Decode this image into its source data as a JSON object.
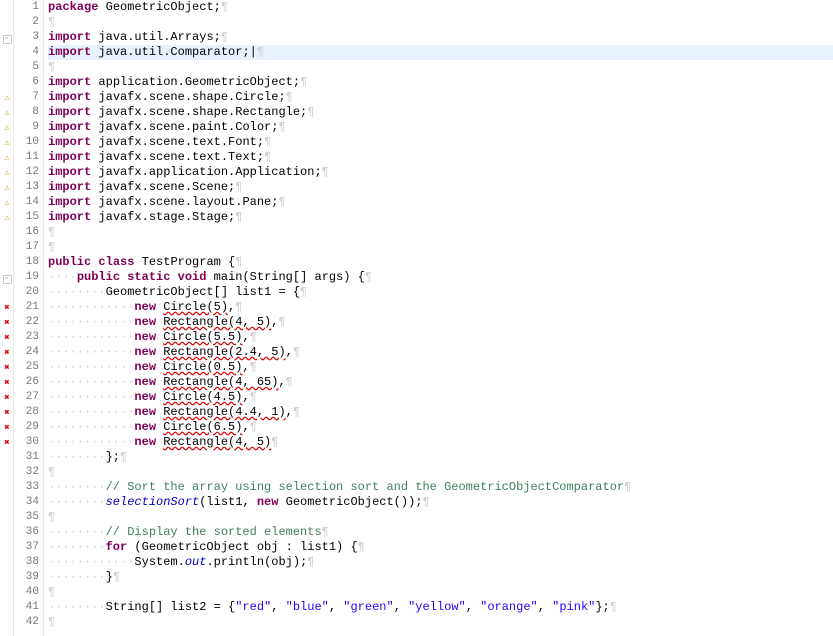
{
  "lines": [
    {
      "num": "1",
      "marker": "",
      "code": [
        {
          "t": "kw",
          "v": "package"
        },
        {
          "t": "ws",
          "v": " "
        },
        {
          "t": "d",
          "v": "GeometricObject;"
        },
        {
          "t": "ws",
          "v": "¶"
        }
      ]
    },
    {
      "num": "2",
      "marker": "",
      "code": [
        {
          "t": "ws",
          "v": "¶"
        }
      ]
    },
    {
      "num": "3",
      "marker": "fold",
      "code": [
        {
          "t": "kw",
          "v": "import"
        },
        {
          "t": "ws",
          "v": " "
        },
        {
          "t": "d",
          "v": "java.util.Arrays;"
        },
        {
          "t": "ws",
          "v": "¶"
        }
      ]
    },
    {
      "num": "4",
      "marker": "",
      "highlight": true,
      "code": [
        {
          "t": "kw",
          "v": "import"
        },
        {
          "t": "ws",
          "v": " "
        },
        {
          "t": "d",
          "v": "java.util.Comparator;"
        },
        {
          "t": "d",
          "v": "|"
        },
        {
          "t": "ws",
          "v": "¶"
        }
      ]
    },
    {
      "num": "5",
      "marker": "",
      "code": [
        {
          "t": "ws",
          "v": "¶"
        }
      ]
    },
    {
      "num": "6",
      "marker": "",
      "code": [
        {
          "t": "kw",
          "v": "import"
        },
        {
          "t": "ws",
          "v": " "
        },
        {
          "t": "d",
          "v": "application.GeometricObject;"
        },
        {
          "t": "ws",
          "v": "¶"
        }
      ]
    },
    {
      "num": "7",
      "marker": "warn",
      "code": [
        {
          "t": "kw",
          "v": "import"
        },
        {
          "t": "ws",
          "v": " "
        },
        {
          "t": "d",
          "v": "javafx.scene.shape.Circle;"
        },
        {
          "t": "ws",
          "v": "¶"
        }
      ]
    },
    {
      "num": "8",
      "marker": "warn",
      "code": [
        {
          "t": "kw",
          "v": "import"
        },
        {
          "t": "ws",
          "v": " "
        },
        {
          "t": "d",
          "v": "javafx.scene.shape.Rectangle;"
        },
        {
          "t": "ws",
          "v": "¶"
        }
      ]
    },
    {
      "num": "9",
      "marker": "warn",
      "code": [
        {
          "t": "kw",
          "v": "import"
        },
        {
          "t": "ws",
          "v": " "
        },
        {
          "t": "d",
          "v": "javafx.scene.paint.Color;"
        },
        {
          "t": "ws",
          "v": "¶"
        }
      ]
    },
    {
      "num": "10",
      "marker": "warn",
      "code": [
        {
          "t": "kw",
          "v": "import"
        },
        {
          "t": "ws",
          "v": " "
        },
        {
          "t": "d",
          "v": "javafx.scene.text.Font;"
        },
        {
          "t": "ws",
          "v": "¶"
        }
      ]
    },
    {
      "num": "11",
      "marker": "warn",
      "code": [
        {
          "t": "kw",
          "v": "import"
        },
        {
          "t": "ws",
          "v": " "
        },
        {
          "t": "d",
          "v": "javafx.scene.text.Text;"
        },
        {
          "t": "ws",
          "v": "¶"
        }
      ]
    },
    {
      "num": "12",
      "marker": "warn",
      "code": [
        {
          "t": "kw",
          "v": "import"
        },
        {
          "t": "ws",
          "v": " "
        },
        {
          "t": "d",
          "v": "javafx.application.Application;"
        },
        {
          "t": "ws",
          "v": "¶"
        }
      ]
    },
    {
      "num": "13",
      "marker": "warn",
      "code": [
        {
          "t": "kw",
          "v": "import"
        },
        {
          "t": "ws",
          "v": " "
        },
        {
          "t": "d",
          "v": "javafx.scene.Scene;"
        },
        {
          "t": "ws",
          "v": "¶"
        }
      ]
    },
    {
      "num": "14",
      "marker": "warn",
      "code": [
        {
          "t": "kw",
          "v": "import"
        },
        {
          "t": "ws",
          "v": " "
        },
        {
          "t": "d",
          "v": "javafx.scene.layout.Pane;"
        },
        {
          "t": "ws",
          "v": "¶"
        }
      ]
    },
    {
      "num": "15",
      "marker": "warn",
      "code": [
        {
          "t": "kw",
          "v": "import"
        },
        {
          "t": "ws",
          "v": " "
        },
        {
          "t": "d",
          "v": "javafx.stage.Stage;"
        },
        {
          "t": "ws",
          "v": "¶"
        }
      ]
    },
    {
      "num": "16",
      "marker": "",
      "code": [
        {
          "t": "ws",
          "v": "¶"
        }
      ]
    },
    {
      "num": "17",
      "marker": "",
      "code": [
        {
          "t": "ws",
          "v": "¶"
        }
      ]
    },
    {
      "num": "18",
      "marker": "",
      "code": [
        {
          "t": "kw",
          "v": "public"
        },
        {
          "t": "ws",
          "v": " "
        },
        {
          "t": "kw",
          "v": "class"
        },
        {
          "t": "ws",
          "v": " "
        },
        {
          "t": "d",
          "v": "TestProgram {"
        },
        {
          "t": "ws",
          "v": "¶"
        }
      ]
    },
    {
      "num": "19",
      "marker": "fold",
      "code": [
        {
          "t": "ws",
          "v": "····"
        },
        {
          "t": "kw",
          "v": "public"
        },
        {
          "t": "ws",
          "v": " "
        },
        {
          "t": "kw",
          "v": "static"
        },
        {
          "t": "ws",
          "v": " "
        },
        {
          "t": "kw",
          "v": "void"
        },
        {
          "t": "ws",
          "v": " "
        },
        {
          "t": "d",
          "v": "main(String[] args) {"
        },
        {
          "t": "ws",
          "v": "¶"
        }
      ]
    },
    {
      "num": "20",
      "marker": "",
      "code": [
        {
          "t": "ws",
          "v": "········"
        },
        {
          "t": "d",
          "v": "GeometricObject[] list1 = {"
        },
        {
          "t": "ws",
          "v": "¶"
        }
      ]
    },
    {
      "num": "21",
      "marker": "err",
      "code": [
        {
          "t": "ws",
          "v": "············"
        },
        {
          "t": "kw",
          "v": "new"
        },
        {
          "t": "ws",
          "v": " "
        },
        {
          "t": "err-u",
          "v": "Circle(5)"
        },
        {
          "t": "d",
          "v": ","
        },
        {
          "t": "ws",
          "v": "¶"
        }
      ]
    },
    {
      "num": "22",
      "marker": "err",
      "code": [
        {
          "t": "ws",
          "v": "············"
        },
        {
          "t": "kw",
          "v": "new"
        },
        {
          "t": "ws",
          "v": " "
        },
        {
          "t": "err-u",
          "v": "Rectangle(4, 5)"
        },
        {
          "t": "d",
          "v": ","
        },
        {
          "t": "ws",
          "v": "¶"
        }
      ]
    },
    {
      "num": "23",
      "marker": "err",
      "code": [
        {
          "t": "ws",
          "v": "············"
        },
        {
          "t": "kw",
          "v": "new"
        },
        {
          "t": "ws",
          "v": " "
        },
        {
          "t": "err-u",
          "v": "Circle(5.5)"
        },
        {
          "t": "d",
          "v": ","
        },
        {
          "t": "ws",
          "v": "¶"
        }
      ]
    },
    {
      "num": "24",
      "marker": "err",
      "code": [
        {
          "t": "ws",
          "v": "············"
        },
        {
          "t": "kw",
          "v": "new"
        },
        {
          "t": "ws",
          "v": " "
        },
        {
          "t": "err-u",
          "v": "Rectangle(2.4, 5)"
        },
        {
          "t": "d",
          "v": ","
        },
        {
          "t": "ws",
          "v": "¶"
        }
      ]
    },
    {
      "num": "25",
      "marker": "err",
      "code": [
        {
          "t": "ws",
          "v": "············"
        },
        {
          "t": "kw",
          "v": "new"
        },
        {
          "t": "ws",
          "v": " "
        },
        {
          "t": "err-u",
          "v": "Circle(0.5)"
        },
        {
          "t": "d",
          "v": ","
        },
        {
          "t": "ws",
          "v": "¶"
        }
      ]
    },
    {
      "num": "26",
      "marker": "err",
      "code": [
        {
          "t": "ws",
          "v": "············"
        },
        {
          "t": "kw",
          "v": "new"
        },
        {
          "t": "ws",
          "v": " "
        },
        {
          "t": "err-u",
          "v": "Rectangle(4, 65)"
        },
        {
          "t": "d",
          "v": ","
        },
        {
          "t": "ws",
          "v": "¶"
        }
      ]
    },
    {
      "num": "27",
      "marker": "err",
      "code": [
        {
          "t": "ws",
          "v": "············"
        },
        {
          "t": "kw",
          "v": "new"
        },
        {
          "t": "ws",
          "v": " "
        },
        {
          "t": "err-u",
          "v": "Circle(4.5)"
        },
        {
          "t": "d",
          "v": ","
        },
        {
          "t": "ws",
          "v": "¶"
        }
      ]
    },
    {
      "num": "28",
      "marker": "err",
      "code": [
        {
          "t": "ws",
          "v": "············"
        },
        {
          "t": "kw",
          "v": "new"
        },
        {
          "t": "ws",
          "v": " "
        },
        {
          "t": "err-u",
          "v": "Rectangle(4.4, 1)"
        },
        {
          "t": "d",
          "v": ","
        },
        {
          "t": "ws",
          "v": "¶"
        }
      ]
    },
    {
      "num": "29",
      "marker": "err",
      "code": [
        {
          "t": "ws",
          "v": "············"
        },
        {
          "t": "kw",
          "v": "new"
        },
        {
          "t": "ws",
          "v": " "
        },
        {
          "t": "err-u",
          "v": "Circle(6.5)"
        },
        {
          "t": "d",
          "v": ","
        },
        {
          "t": "ws",
          "v": "¶"
        }
      ]
    },
    {
      "num": "30",
      "marker": "err",
      "code": [
        {
          "t": "ws",
          "v": "············"
        },
        {
          "t": "kw",
          "v": "new"
        },
        {
          "t": "ws",
          "v": " "
        },
        {
          "t": "err-u",
          "v": "Rectangle(4, 5)"
        },
        {
          "t": "ws",
          "v": "¶"
        }
      ]
    },
    {
      "num": "31",
      "marker": "",
      "code": [
        {
          "t": "ws",
          "v": "········"
        },
        {
          "t": "d",
          "v": "};"
        },
        {
          "t": "ws",
          "v": "¶"
        }
      ]
    },
    {
      "num": "32",
      "marker": "",
      "code": [
        {
          "t": "ws",
          "v": "¶"
        }
      ]
    },
    {
      "num": "33",
      "marker": "",
      "code": [
        {
          "t": "ws",
          "v": "········"
        },
        {
          "t": "com",
          "v": "// Sort the array using selection sort and the GeometricObjectComparator"
        },
        {
          "t": "ws",
          "v": "¶"
        }
      ]
    },
    {
      "num": "34",
      "marker": "",
      "code": [
        {
          "t": "ws",
          "v": "········"
        },
        {
          "t": "fld",
          "v": "selectionSort"
        },
        {
          "t": "d",
          "v": "(list1, "
        },
        {
          "t": "kw",
          "v": "new"
        },
        {
          "t": "d",
          "v": " GeometricObject());"
        },
        {
          "t": "ws",
          "v": "¶"
        }
      ]
    },
    {
      "num": "35",
      "marker": "",
      "code": [
        {
          "t": "ws",
          "v": "¶"
        }
      ]
    },
    {
      "num": "36",
      "marker": "",
      "code": [
        {
          "t": "ws",
          "v": "········"
        },
        {
          "t": "com",
          "v": "// Display the sorted elements"
        },
        {
          "t": "ws",
          "v": "¶"
        }
      ]
    },
    {
      "num": "37",
      "marker": "",
      "code": [
        {
          "t": "ws",
          "v": "········"
        },
        {
          "t": "kw",
          "v": "for"
        },
        {
          "t": "d",
          "v": " (GeometricObject obj : list1) {"
        },
        {
          "t": "ws",
          "v": "¶"
        }
      ]
    },
    {
      "num": "38",
      "marker": "",
      "code": [
        {
          "t": "ws",
          "v": "············"
        },
        {
          "t": "d",
          "v": "System."
        },
        {
          "t": "fld",
          "v": "out"
        },
        {
          "t": "d",
          "v": ".println(obj);"
        },
        {
          "t": "ws",
          "v": "¶"
        }
      ]
    },
    {
      "num": "39",
      "marker": "",
      "code": [
        {
          "t": "ws",
          "v": "········"
        },
        {
          "t": "d",
          "v": "}"
        },
        {
          "t": "ws",
          "v": "¶"
        }
      ]
    },
    {
      "num": "40",
      "marker": "",
      "code": [
        {
          "t": "ws",
          "v": "¶"
        }
      ]
    },
    {
      "num": "41",
      "marker": "",
      "code": [
        {
          "t": "ws",
          "v": "········"
        },
        {
          "t": "d",
          "v": "String[] list2 = {"
        },
        {
          "t": "str",
          "v": "\"red\""
        },
        {
          "t": "d",
          "v": ", "
        },
        {
          "t": "str",
          "v": "\"blue\""
        },
        {
          "t": "d",
          "v": ", "
        },
        {
          "t": "str",
          "v": "\"green\""
        },
        {
          "t": "d",
          "v": ", "
        },
        {
          "t": "str",
          "v": "\"yellow\""
        },
        {
          "t": "d",
          "v": ", "
        },
        {
          "t": "str",
          "v": "\"orange\""
        },
        {
          "t": "d",
          "v": ", "
        },
        {
          "t": "str",
          "v": "\"pink\""
        },
        {
          "t": "d",
          "v": "};"
        },
        {
          "t": "ws",
          "v": "¶"
        }
      ]
    },
    {
      "num": "42",
      "marker": "",
      "code": [
        {
          "t": "ws",
          "v": "¶"
        }
      ]
    }
  ],
  "markers": {
    "err_glyph": "✖",
    "warn_glyph": "⚠",
    "fold_glyph": "⊟"
  }
}
